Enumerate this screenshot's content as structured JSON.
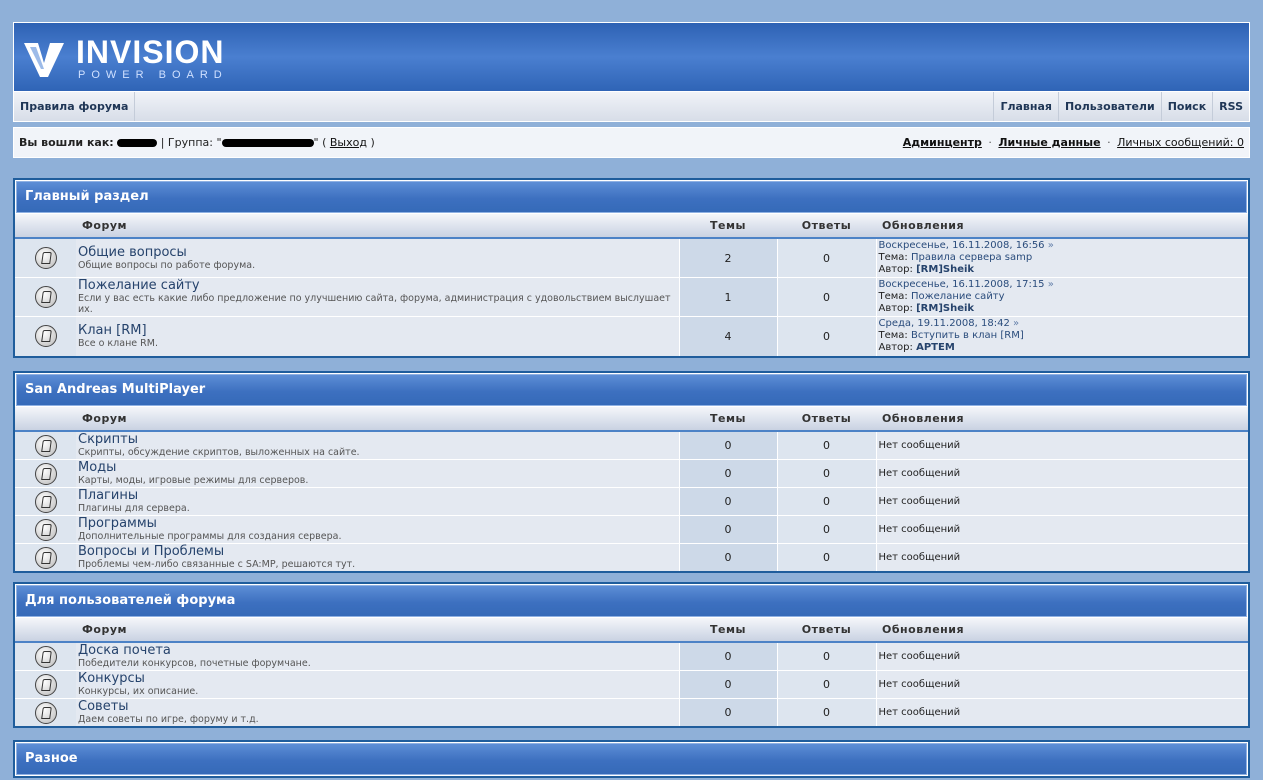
{
  "logo": {
    "big": "INVISION",
    "small": "POWER BOARD"
  },
  "nav": {
    "left": [
      "Правила форума"
    ],
    "right": [
      "Главная",
      "Пользователи",
      "Поиск",
      "RSS"
    ]
  },
  "user_bar": {
    "logged_label": "Вы вошли как:",
    "group_label": "| Группа: \"",
    "group_close": "\" (",
    "logout": "Выход",
    "logout_close": ")",
    "admin": "Админцентр",
    "profile": "Личные данные",
    "messages": "Личных сообщений: 0",
    "dot": "·"
  },
  "columns": {
    "forum": "Форум",
    "topics": "Темы",
    "replies": "Ответы",
    "updates": "Обновления"
  },
  "labels": {
    "topic": "Тема:",
    "author": "Автор:",
    "arrow": "»"
  },
  "categories": [
    {
      "title": "Главный раздел",
      "forums": [
        {
          "name": "Общие вопросы",
          "desc": "Общие вопросы по работе форума.",
          "topics": "2",
          "replies": "0",
          "last": {
            "date": "Воскресенье, 16.11.2008, 16:56",
            "topic": "Правила сервера samp",
            "author": "[RM]Sheik"
          }
        },
        {
          "name": "Пожелание сайту",
          "desc": "Если у вас есть какие либо предложение по улучшению сайта, форума, администрация с удовольствием выслушает их.",
          "topics": "1",
          "replies": "0",
          "last": {
            "date": "Воскресенье, 16.11.2008, 17:15",
            "topic": "Пожелание сайту",
            "author": "[RM]Sheik"
          }
        },
        {
          "name": "Клан [RM]",
          "desc": "Все о клане RM.",
          "topics": "4",
          "replies": "0",
          "last": {
            "date": "Среда, 19.11.2008, 18:42",
            "topic": "Вступить в клан [RM]",
            "author": "АРТЕМ"
          }
        }
      ]
    },
    {
      "title": "San Andreas MultiPlayer",
      "forums": [
        {
          "name": "Скрипты",
          "desc": "Скрипты, обсуждение скриптов, выложенных на сайте.",
          "topics": "0",
          "replies": "0",
          "none": "Нет сообщений"
        },
        {
          "name": "Моды",
          "desc": "Карты, моды, игровые режимы для серверов.",
          "topics": "0",
          "replies": "0",
          "none": "Нет сообщений"
        },
        {
          "name": "Плагины",
          "desc": "Плагины для сервера.",
          "topics": "0",
          "replies": "0",
          "none": "Нет сообщений"
        },
        {
          "name": "Программы",
          "desc": "Дополнительные программы для создания сервера.",
          "topics": "0",
          "replies": "0",
          "none": "Нет сообщений"
        },
        {
          "name": "Вопросы и Проблемы",
          "desc": "Проблемы чем-либо связанные с SA:MP, решаются тут.",
          "topics": "0",
          "replies": "0",
          "none": "Нет сообщений"
        }
      ]
    },
    {
      "title": "Для пользователей форума",
      "forums": [
        {
          "name": "Доска почета",
          "desc": "Победители конкурсов, почетные форумчане.",
          "topics": "0",
          "replies": "0",
          "none": "Нет сообщений"
        },
        {
          "name": "Конкурсы",
          "desc": "Конкурсы, их описание.",
          "topics": "0",
          "replies": "0",
          "none": "Нет сообщений"
        },
        {
          "name": "Советы",
          "desc": "Даем советы по игре, форуму и т.д.",
          "topics": "0",
          "replies": "0",
          "none": "Нет сообщений"
        }
      ]
    },
    {
      "title": "Разное",
      "forums": []
    }
  ]
}
